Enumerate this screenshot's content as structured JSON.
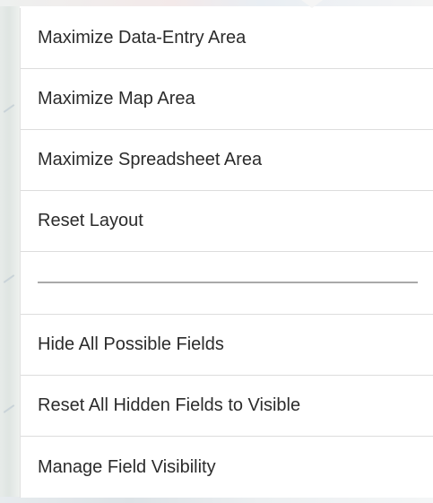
{
  "menu": {
    "items": [
      {
        "label": "Maximize Data-Entry Area"
      },
      {
        "label": "Maximize Map Area"
      },
      {
        "label": "Maximize Spreadsheet Area"
      },
      {
        "label": "Reset Layout"
      }
    ],
    "items_after_separator": [
      {
        "label": "Hide All Possible Fields"
      },
      {
        "label": "Reset All Hidden Fields to Visible"
      },
      {
        "label": "Manage Field Visibility"
      }
    ]
  }
}
